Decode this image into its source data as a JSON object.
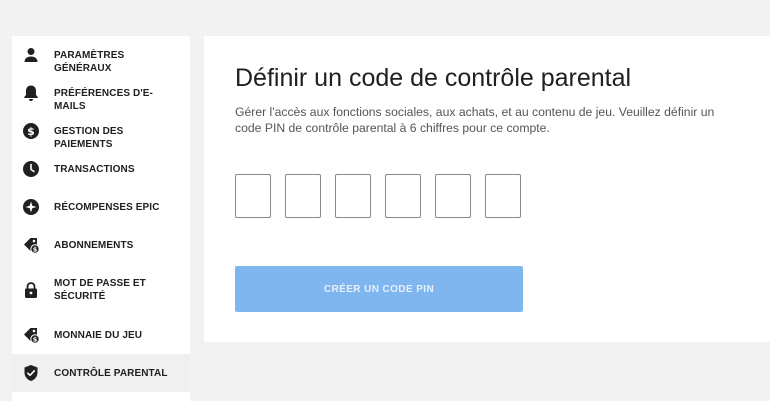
{
  "sidebar": {
    "items": [
      {
        "label": "PARAMÈTRES GÉNÉRAUX",
        "icon": "person-icon"
      },
      {
        "label": "PRÉFÉRENCES D'E-MAILS",
        "icon": "bell-icon"
      },
      {
        "label": "GESTION DES PAIEMENTS",
        "icon": "dollar-circle-icon"
      },
      {
        "label": "TRANSACTIONS",
        "icon": "clock-icon"
      },
      {
        "label": "RÉCOMPENSES EPIC",
        "icon": "star-circle-icon"
      },
      {
        "label": "ABONNEMENTS",
        "icon": "subscription-icon"
      },
      {
        "label": "MOT DE PASSE ET SÉCURITÉ",
        "icon": "lock-icon"
      },
      {
        "label": "MONNAIE DU JEU",
        "icon": "coin-tag-icon"
      },
      {
        "label": "CONTRÔLE PARENTAL",
        "icon": "shield-check-icon",
        "active": true
      }
    ]
  },
  "main": {
    "title": "Définir un code de contrôle parental",
    "description": "Gérer l'accès aux fonctions sociales, aux achats, et au contenu de jeu. Veuillez définir un code PIN de contrôle parental à 6 chiffres pour ce compte.",
    "pin": {
      "digits": [
        "",
        "",
        "",
        "",
        "",
        ""
      ]
    },
    "create_button": "CRÉER UN CODE PIN"
  },
  "colors": {
    "background": "#f2f2f2",
    "panel": "#ffffff",
    "button_disabled": "#7fb6ef",
    "active_item": "#f0f0f0"
  }
}
